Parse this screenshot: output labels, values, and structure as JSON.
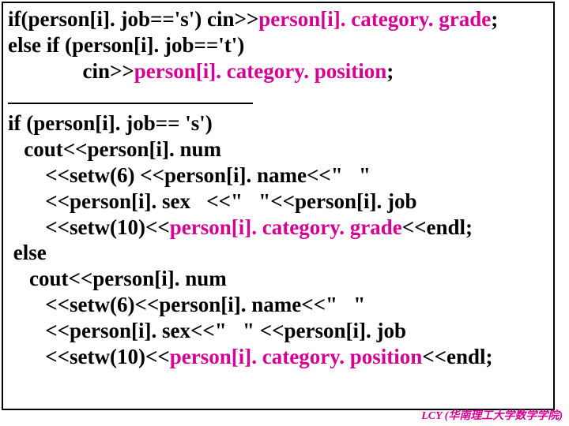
{
  "code": {
    "l1a": "if(person[i]. job=='s') cin>>",
    "l1b": "person[i]. category. grade",
    "l1c": ";",
    "l2": "else if (person[i]. job=='t')",
    "l3a": "              cin>>",
    "l3b": "person[i]. category. position",
    "l3c": ";",
    "l5": "if (person[i]. job== 's')",
    "l6": "   cout<<person[i]. num",
    "l7": "       <<setw(6) <<person[i]. name<<\"   \"",
    "l8": "       <<person[i]. sex   <<\"   \"<<person[i]. job",
    "l9a": "       <<setw(10)<<",
    "l9b": "person[i]. category. grade",
    "l9c": "<<endl;",
    "l10": " else",
    "l11": "    cout<<person[i]. num",
    "l12": "       <<setw(6)<<person[i]. name<<\"   \"",
    "l13": "       <<person[i]. sex<<\"   \" <<person[i]. job",
    "l14a": "       <<setw(10)<<",
    "l14b": "person[i]. category. position",
    "l14c": "<<endl;"
  },
  "footer": "LCY (华南理工大学数学学院)"
}
